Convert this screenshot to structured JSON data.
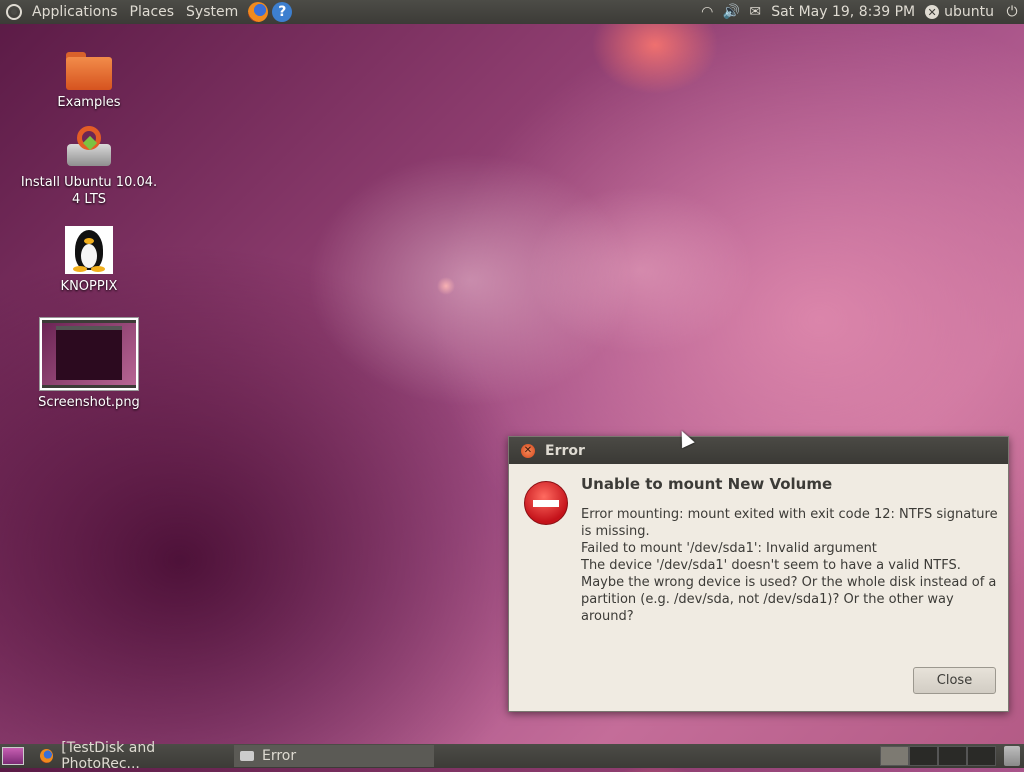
{
  "top_panel": {
    "menus": [
      "Applications",
      "Places",
      "System"
    ],
    "clock": "Sat May 19,  8:39 PM",
    "user": "ubuntu"
  },
  "desktop_icons": [
    {
      "label": "Examples",
      "icon": "folder-icon"
    },
    {
      "label": "Install Ubuntu 10.04.\n4 LTS",
      "icon": "installer-icon"
    },
    {
      "label": "KNOPPIX",
      "icon": "tux-icon"
    },
    {
      "label": "Screenshot.png",
      "icon": "image-thumbnail-icon"
    }
  ],
  "dialog": {
    "title": "Error",
    "heading": "Unable to mount New Volume",
    "body_lines": [
      "Error mounting: mount exited with exit code 12: NTFS signature is missing.",
      "Failed to mount '/dev/sda1': Invalid argument",
      "The device '/dev/sda1' doesn't seem to have a valid NTFS.",
      "Maybe the wrong device is used? Or the whole disk instead of a partition (e.g. /dev/sda, not /dev/sda1)? Or the other way around?"
    ],
    "close_label": "Close"
  },
  "taskbar": {
    "tasks": [
      {
        "label": "[TestDisk and PhotoRec...",
        "icon": "firefox-icon",
        "active": false
      },
      {
        "label": "Error",
        "icon": "error-window-icon",
        "active": true
      }
    ]
  }
}
